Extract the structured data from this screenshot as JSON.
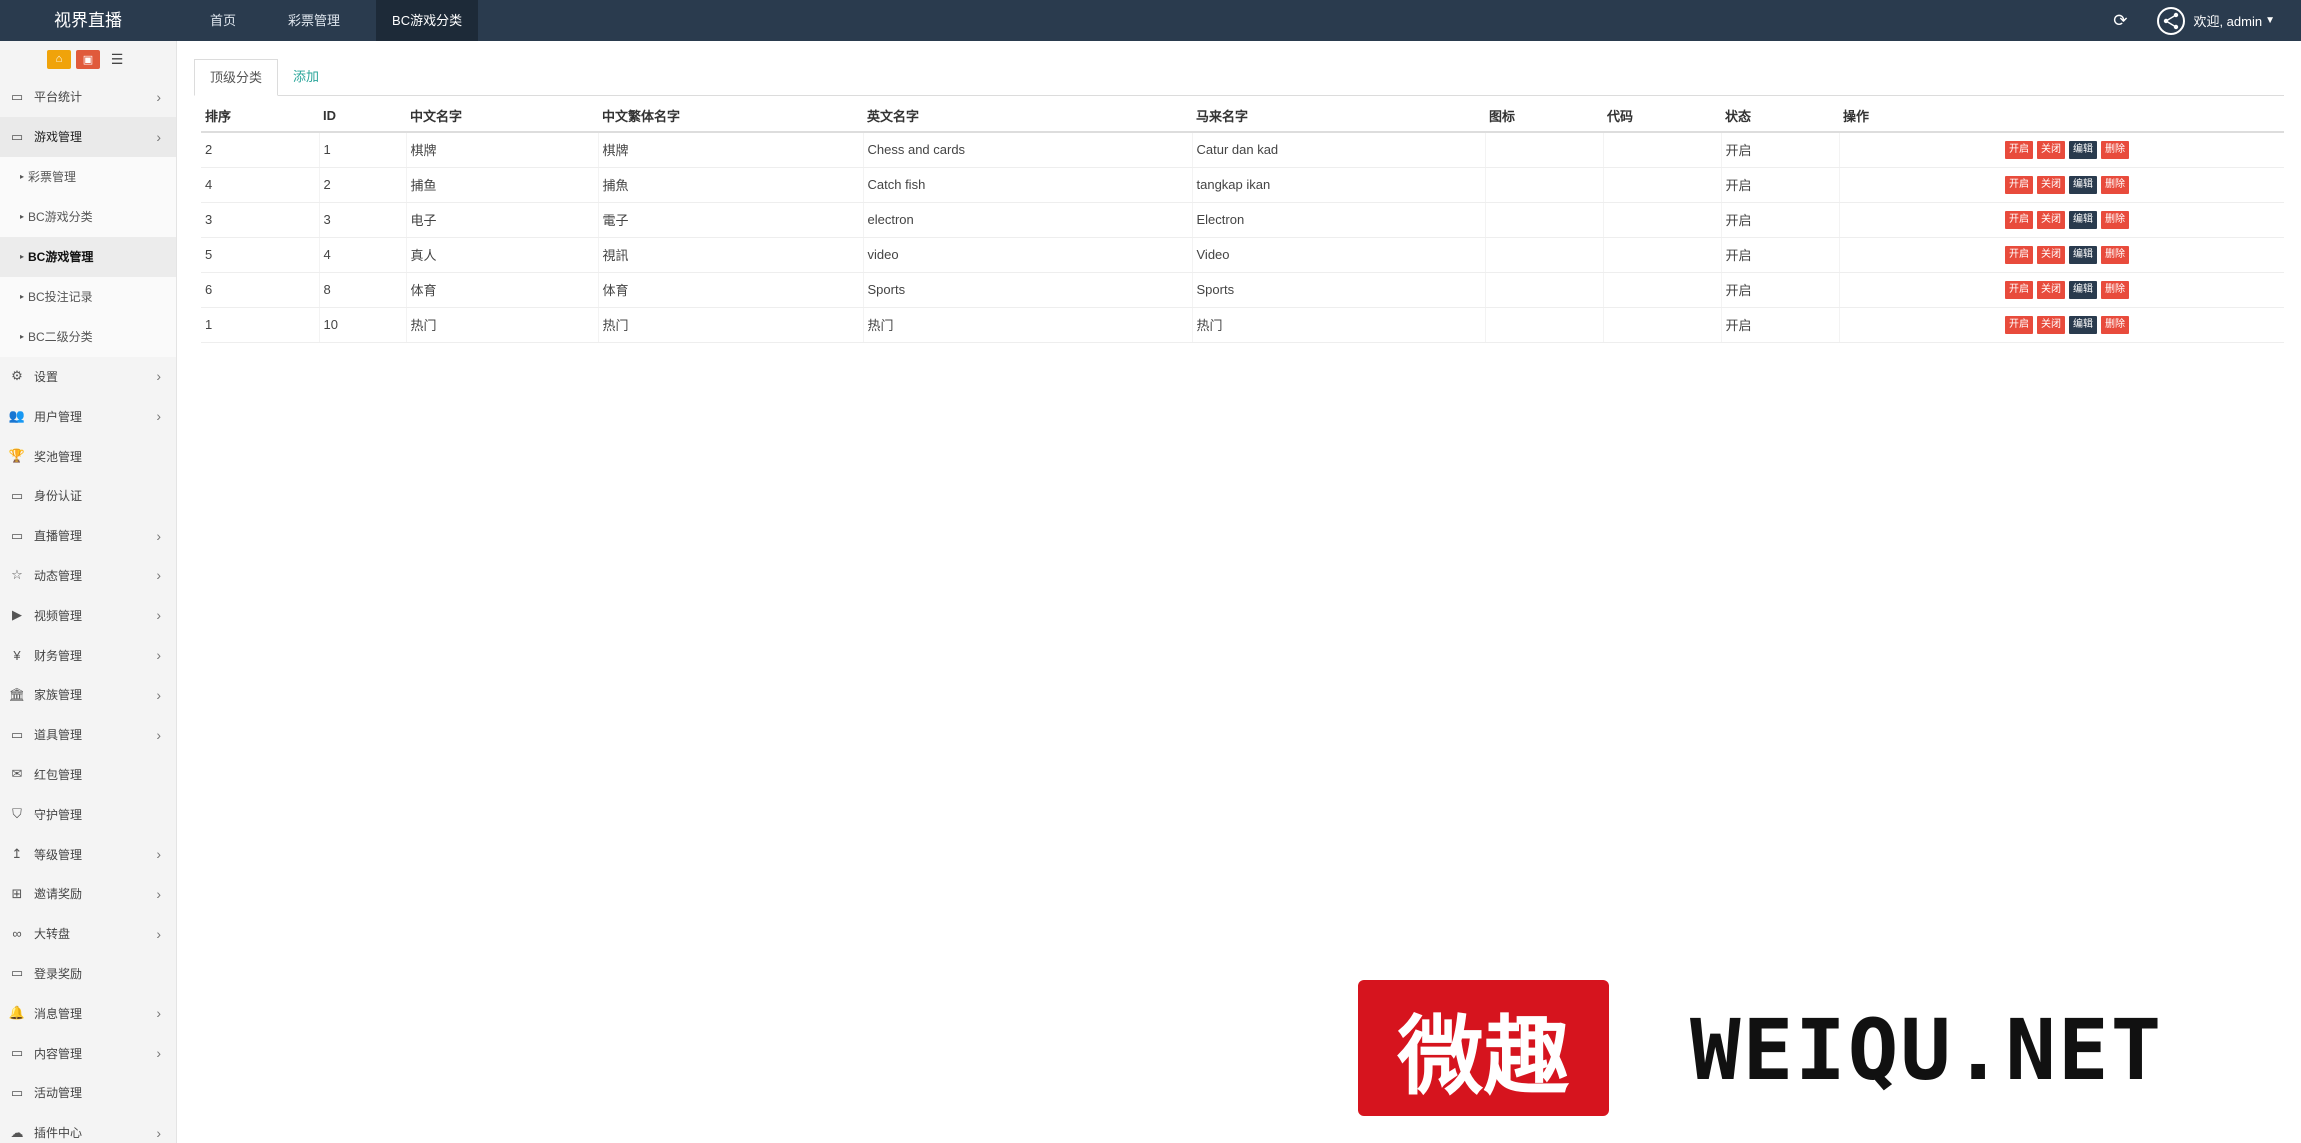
{
  "header": {
    "brand": "视界直播",
    "nav": [
      "首页",
      "彩票管理",
      "BC游戏分类"
    ],
    "welcome": "欢迎, admin"
  },
  "sidebar": {
    "tools": [
      "home-icon",
      "delete-icon",
      "list-icon"
    ],
    "items": [
      {
        "label": "平台统计",
        "icon": "monitor-icon",
        "chevron": true
      },
      {
        "label": "游戏管理",
        "icon": "monitor-icon",
        "chevron": true,
        "open": true
      },
      {
        "label": "彩票管理",
        "sub": true
      },
      {
        "label": "BC游戏分类",
        "sub": true
      },
      {
        "label": "BC游戏管理",
        "sub": true,
        "current": true
      },
      {
        "label": "BC投注记录",
        "sub": true
      },
      {
        "label": "BC二级分类",
        "sub": true
      },
      {
        "label": "设置",
        "icon": "gears-icon",
        "chevron": true
      },
      {
        "label": "用户管理",
        "icon": "users-icon",
        "chevron": true
      },
      {
        "label": "奖池管理",
        "icon": "trophy-icon",
        "chevron": false
      },
      {
        "label": "身份认证",
        "icon": "monitor-icon",
        "chevron": false
      },
      {
        "label": "直播管理",
        "icon": "monitor-icon",
        "chevron": true
      },
      {
        "label": "动态管理",
        "icon": "star-icon",
        "chevron": true
      },
      {
        "label": "视频管理",
        "icon": "video-icon",
        "chevron": true
      },
      {
        "label": "财务管理",
        "icon": "yen-icon",
        "chevron": true
      },
      {
        "label": "家族管理",
        "icon": "bank-icon",
        "chevron": true
      },
      {
        "label": "道具管理",
        "icon": "monitor-icon",
        "chevron": true
      },
      {
        "label": "红包管理",
        "icon": "envelope-icon",
        "chevron": false
      },
      {
        "label": "守护管理",
        "icon": "shield-icon",
        "chevron": false
      },
      {
        "label": "等级管理",
        "icon": "level-up-icon",
        "chevron": true
      },
      {
        "label": "邀请奖励",
        "icon": "sitemap-icon",
        "chevron": true
      },
      {
        "label": "大转盘",
        "icon": "gamepad-icon",
        "chevron": true
      },
      {
        "label": "登录奖励",
        "icon": "monitor-icon",
        "chevron": false
      },
      {
        "label": "消息管理",
        "icon": "bell-icon",
        "chevron": true
      },
      {
        "label": "内容管理",
        "icon": "monitor-icon",
        "chevron": true
      },
      {
        "label": "活动管理",
        "icon": "monitor-icon",
        "chevron": false
      },
      {
        "label": "插件中心",
        "icon": "cloud-icon",
        "chevron": true
      }
    ]
  },
  "tabs": [
    "顶级分类",
    "添加"
  ],
  "table": {
    "headers": [
      "排序",
      "ID",
      "中文名字",
      "中文繁体名字",
      "英文名字",
      "马来名字",
      "图标",
      "代码",
      "状态",
      "操作"
    ],
    "rows": [
      [
        "2",
        "1",
        "棋牌",
        "棋牌",
        "Chess and cards",
        "Catur dan kad",
        "",
        "",
        "开启"
      ],
      [
        "4",
        "2",
        "捕鱼",
        "捕魚",
        "Catch fish",
        "tangkap ikan",
        "",
        "",
        "开启"
      ],
      [
        "3",
        "3",
        "电子",
        "電子",
        "electron",
        "Electron",
        "",
        "",
        "开启"
      ],
      [
        "5",
        "4",
        "真人",
        "視訊",
        "video",
        "Video",
        "",
        "",
        "开启"
      ],
      [
        "6",
        "8",
        "体育",
        "体育",
        "Sports",
        "Sports",
        "",
        "",
        "开启"
      ],
      [
        "1",
        "10",
        "热门",
        "热门",
        "热门",
        "热门",
        "",
        "",
        "开启"
      ]
    ],
    "actions": [
      "开启",
      "关闭",
      "编辑",
      "删除"
    ]
  },
  "watermark": {
    "cn": "微趣",
    "en": "WEIQU.NET"
  },
  "colors": {
    "topbar": "#2a3b4e",
    "danger": "#e84b3c",
    "dark": "#2a3b4e",
    "link": "#2aa59a",
    "watermark_red": "#d6141e"
  }
}
